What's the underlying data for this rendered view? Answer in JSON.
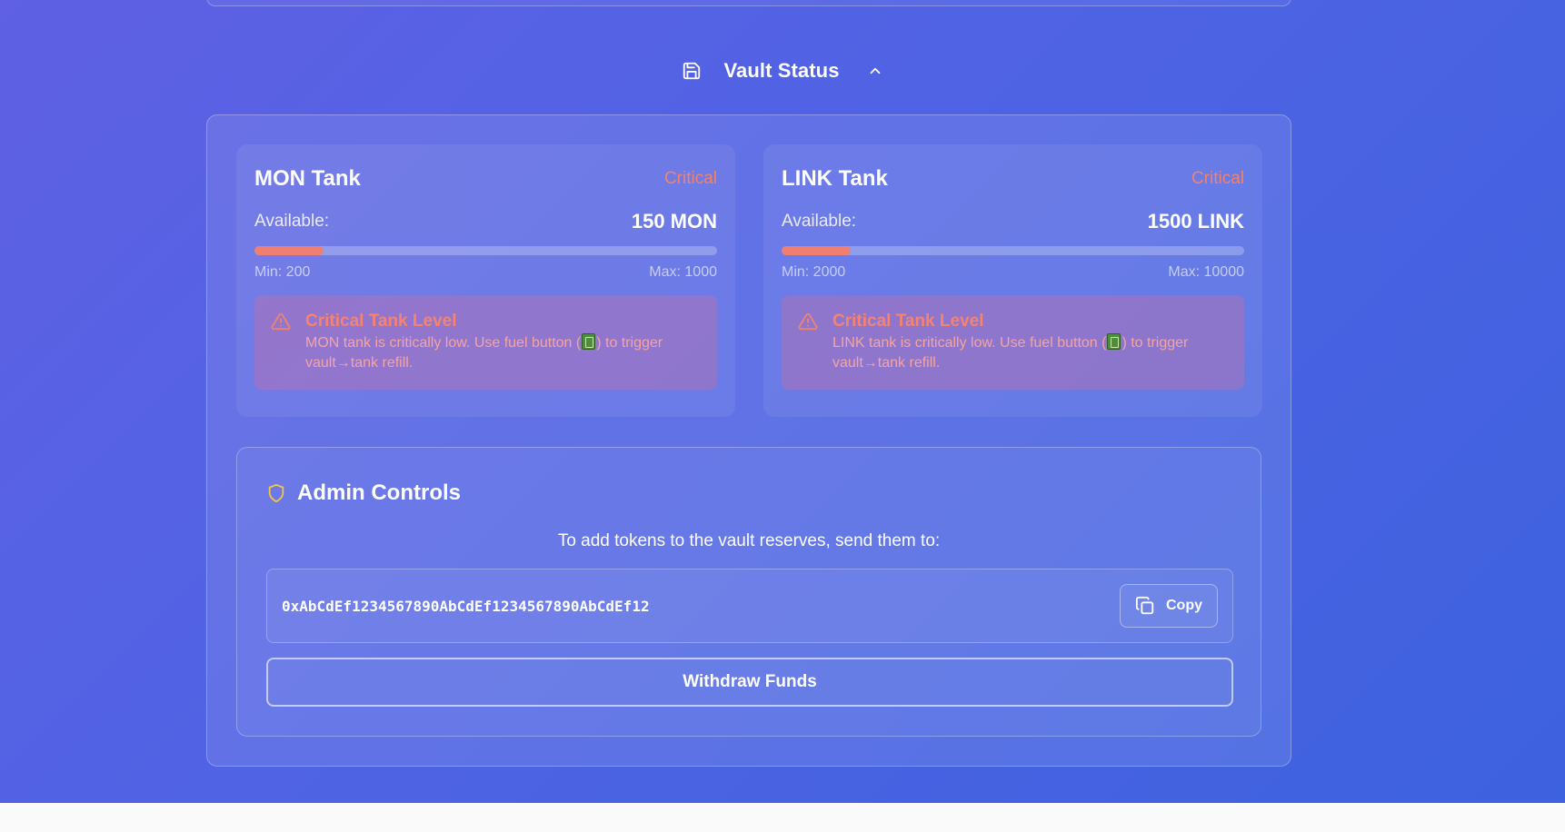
{
  "section": {
    "title": "Vault Status",
    "icon": "save-icon",
    "toggle_icon": "chevron-up-icon"
  },
  "tanks": [
    {
      "name": "MON Tank",
      "status": "Critical",
      "available_label": "Available:",
      "available_value": "150 MON",
      "fill_fraction": 0.15,
      "min_label": "Min: 200",
      "max_label": "Max: 1000",
      "alert": {
        "title": "Critical Tank Level",
        "text_before": "MON tank is critically low. Use fuel button (",
        "text_after": ") to trigger vault→tank refill."
      }
    },
    {
      "name": "LINK Tank",
      "status": "Critical",
      "available_label": "Available:",
      "available_value": "1500 LINK",
      "fill_fraction": 0.15,
      "min_label": "Min: 2000",
      "max_label": "Max: 10000",
      "alert": {
        "title": "Critical Tank Level",
        "text_before": "LINK tank is critically low. Use fuel button (",
        "text_after": ") to trigger vault→tank refill."
      }
    }
  ],
  "admin": {
    "title": "Admin Controls",
    "description": "To add tokens to the vault reserves, send them to:",
    "address": "0xAbCdEf1234567890AbCdEf1234567890AbCdEf12",
    "copy_label": "Copy",
    "withdraw_label": "Withdraw Funds"
  },
  "colors": {
    "critical": "#f0836f",
    "progress_fill": "#ef7f72",
    "shield": "#f5c542"
  }
}
